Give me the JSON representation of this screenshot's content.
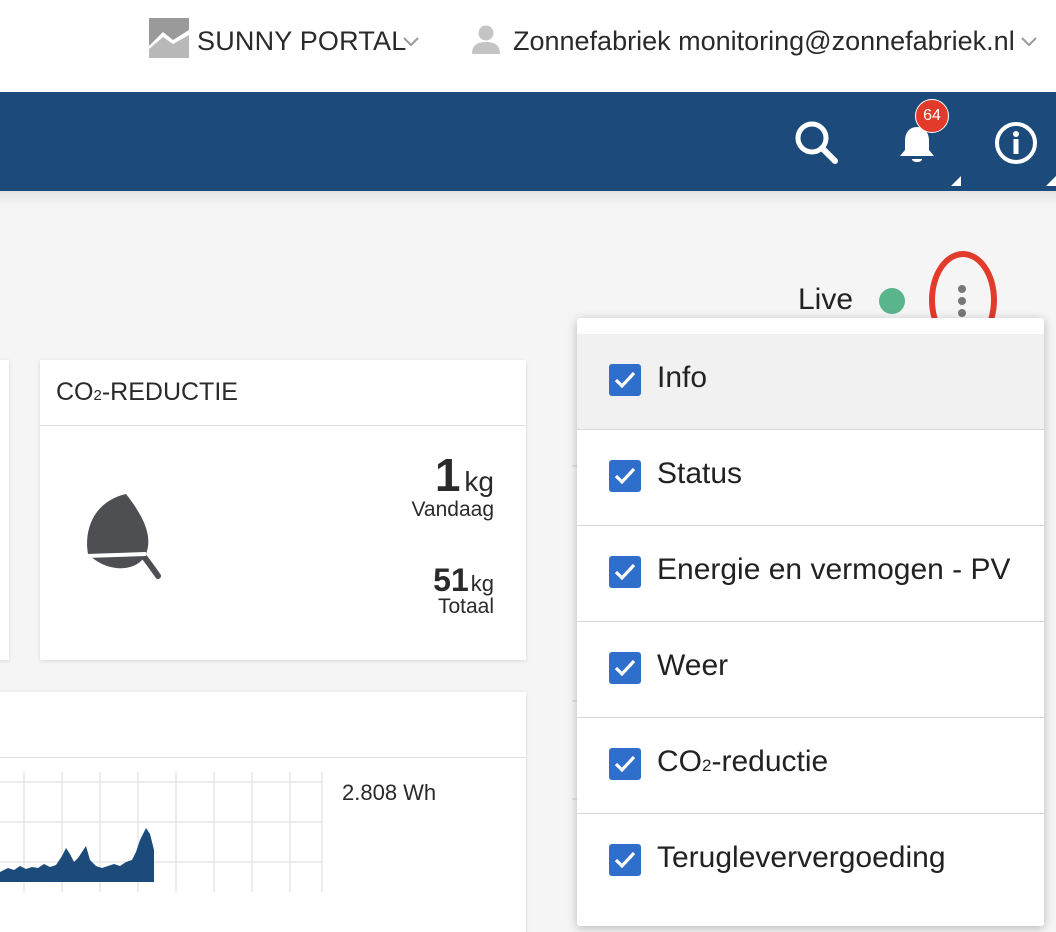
{
  "header": {
    "portal_name": "SUNNY PORTAL",
    "user_label": "Zonnefabriek monitoring@zonnefabriek.nl"
  },
  "navbar": {
    "notification_count": "64",
    "icons": [
      "search-icon",
      "bell-icon",
      "info-icon"
    ]
  },
  "status": {
    "live_label": "Live",
    "live_color": "#5bb58c"
  },
  "co2_card": {
    "title_prefix": "CO",
    "title_sub": "2",
    "title_suffix": "-REDUCTIE",
    "today_value": "1",
    "today_unit": "kg",
    "today_label": "Vandaag",
    "total_value": "51",
    "total_unit": "kg",
    "total_label": "Totaal"
  },
  "energy_card": {
    "value_label": "2.808 Wh"
  },
  "menu": {
    "items": [
      {
        "label": "Info",
        "checked": true
      },
      {
        "label": "Status",
        "checked": true
      },
      {
        "label": "Energie en vermogen - PV",
        "checked": true
      },
      {
        "label": "Weer",
        "checked": true
      },
      {
        "label_prefix": "CO",
        "label_sub": "2",
        "label_suffix": "-reductie",
        "checked": true
      },
      {
        "label": "Terugleververgoeding",
        "checked": true
      }
    ]
  },
  "colors": {
    "nav_blue": "#1b4a7b",
    "badge_red": "#e23a2b",
    "checkbox_blue": "#2f6fcb",
    "highlight_red": "#e23a2b"
  }
}
